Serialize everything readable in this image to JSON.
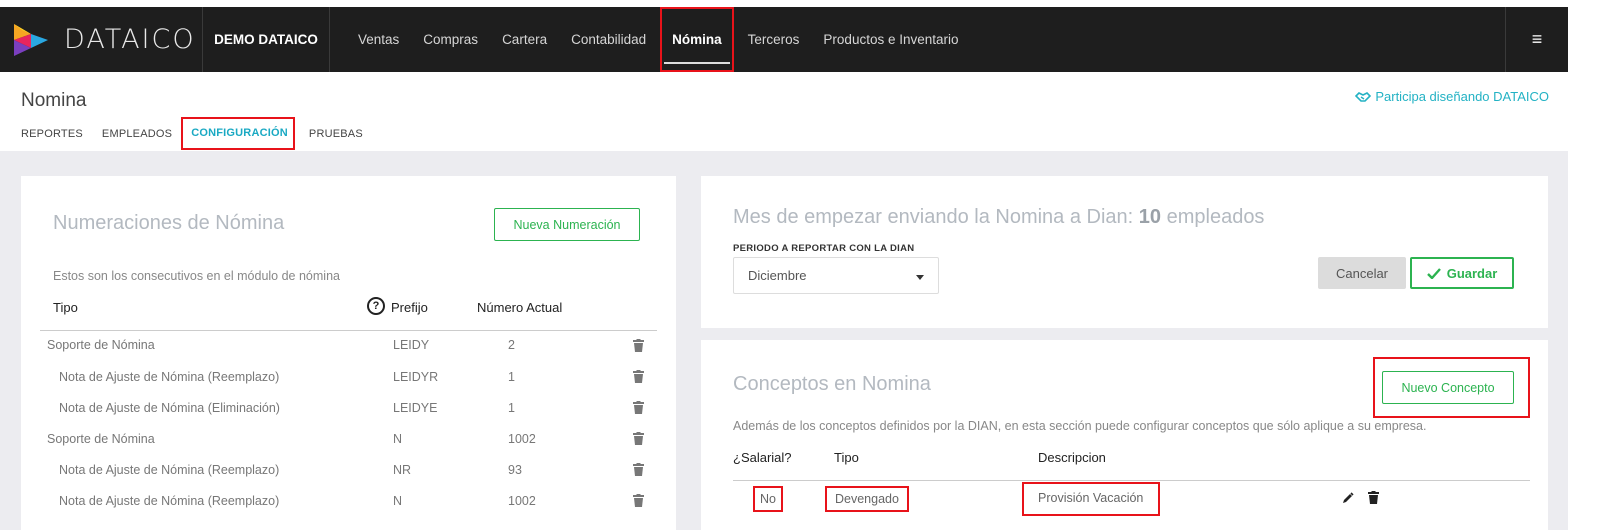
{
  "brand": {
    "name": "DATAICO"
  },
  "company": "DEMO DATAICO",
  "nav": [
    {
      "label": "Ventas"
    },
    {
      "label": "Compras"
    },
    {
      "label": "Cartera"
    },
    {
      "label": "Contabilidad"
    },
    {
      "label": "Nómina"
    },
    {
      "label": "Terceros"
    },
    {
      "label": "Productos e Inventario"
    }
  ],
  "menu_icon": "≡",
  "page": {
    "title": "Nomina",
    "participa": "Participa diseñando DATAICO",
    "tabs": [
      {
        "label": "REPORTES"
      },
      {
        "label": "EMPLEADOS"
      },
      {
        "label": "CONFIGURACIÓN"
      },
      {
        "label": "PRUEBAS"
      }
    ]
  },
  "numeraciones": {
    "title": "Numeraciones de Nómina",
    "new_button": "Nueva Numeración",
    "description": "Estos son los consecutivos en el módulo de nómina",
    "columns": {
      "tipo": "Tipo",
      "help": "?",
      "prefijo": "Prefijo",
      "numero": "Número Actual"
    },
    "rows": [
      {
        "tipo": "Soporte de Nómina",
        "prefijo": "LEIDY",
        "numero": "2"
      },
      {
        "tipo": "Nota de Ajuste de Nómina (Reemplazo)",
        "prefijo": "LEIDYR",
        "numero": "1"
      },
      {
        "tipo": "Nota de Ajuste de Nómina (Eliminación)",
        "prefijo": "LEIDYE",
        "numero": "1"
      },
      {
        "tipo": "Soporte de Nómina",
        "prefijo": "N",
        "numero": "1002"
      },
      {
        "tipo": "Nota de Ajuste de Nómina (Reemplazo)",
        "prefijo": "NR",
        "numero": "93"
      },
      {
        "tipo": "Nota de Ajuste de Nómina (Reemplazo)",
        "prefijo": "N",
        "numero": "1002"
      }
    ]
  },
  "mes": {
    "title_prefix": "Mes de empezar enviando la Nomina a Dian:",
    "count": "10",
    "title_suffix": "empleados",
    "periodo_label": "PERIODO A REPORTAR CON LA DIAN",
    "periodo_value": "Diciembre",
    "cancel": "Cancelar",
    "save": "Guardar"
  },
  "conceptos": {
    "title": "Conceptos en Nomina",
    "new_button": "Nuevo Concepto",
    "description": "Además de los conceptos definidos por la DIAN, en esta sección puede configurar conceptos que sólo aplique a su empresa.",
    "columns": {
      "salarial": "¿Salarial?",
      "tipo": "Tipo",
      "descripcion": "Descripcion"
    },
    "rows": [
      {
        "salarial": "No",
        "tipo": "Devengado",
        "descripcion": "Provisión Vacación"
      }
    ]
  },
  "colors": {
    "accent": "#2cb350",
    "highlight": "#e8131a",
    "link": "#23b2c4"
  }
}
